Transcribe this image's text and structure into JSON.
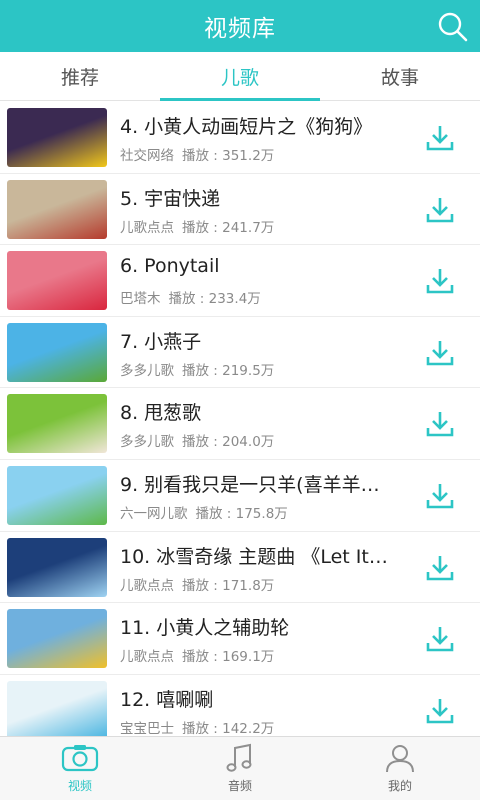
{
  "header": {
    "title": "视频库",
    "search_icon": "search-icon"
  },
  "tabs": [
    {
      "label": "推荐",
      "active": false
    },
    {
      "label": "儿歌",
      "active": true
    },
    {
      "label": "故事",
      "active": false
    }
  ],
  "videos": [
    {
      "title": "4. 小黄人动画短片之《狗狗》",
      "source": "社交网络",
      "plays": "播放 : 351.2万",
      "thumb_colors": [
        "#3b2a52",
        "#f2c81a"
      ]
    },
    {
      "title": "5. 宇宙快递",
      "source": "儿歌点点",
      "plays": "播放 : 241.7万",
      "thumb_colors": [
        "#c9b79a",
        "#b53a2c"
      ]
    },
    {
      "title": "6. Ponytail",
      "source": "巴塔木",
      "plays": "播放 : 233.4万",
      "thumb_colors": [
        "#e9788a",
        "#d9263e"
      ]
    },
    {
      "title": "7. 小燕子",
      "source": "多多儿歌",
      "plays": "播放 : 219.5万",
      "thumb_colors": [
        "#4cb3e6",
        "#5aa836"
      ]
    },
    {
      "title": "8. 甩葱歌",
      "source": "多多儿歌",
      "plays": "播放 : 204.0万",
      "thumb_colors": [
        "#7cc23a",
        "#f1e6d8"
      ]
    },
    {
      "title": "9. 别看我只是一只羊(喜羊羊…",
      "source": "六一网儿歌",
      "plays": "播放 : 175.8万",
      "thumb_colors": [
        "#8ad1f0",
        "#5db848"
      ]
    },
    {
      "title": "10. 冰雪奇缘 主题曲 《Let It G…",
      "source": "儿歌点点",
      "plays": "播放 : 171.8万",
      "thumb_colors": [
        "#1d3f7a",
        "#9fd3f2"
      ]
    },
    {
      "title": "11. 小黄人之辅助轮",
      "source": "儿歌点点",
      "plays": "播放 : 169.1万",
      "thumb_colors": [
        "#6fb0de",
        "#f0c02a"
      ]
    },
    {
      "title": "12. 嘻唰唰",
      "source": "宝宝巴士",
      "plays": "播放 : 142.2万",
      "thumb_colors": [
        "#e7f3f8",
        "#45b3e0"
      ]
    }
  ],
  "bottom_nav": [
    {
      "label": "视频",
      "icon": "camera-icon",
      "active": true
    },
    {
      "label": "音频",
      "icon": "music-note-icon",
      "active": false
    },
    {
      "label": "我的",
      "icon": "user-icon",
      "active": false
    }
  ],
  "colors": {
    "accent": "#2cc5c5",
    "icon_gray": "#8f8f8f"
  }
}
